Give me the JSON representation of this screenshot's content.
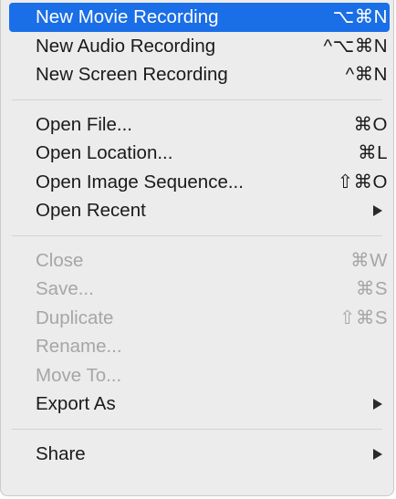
{
  "menu": {
    "groups": [
      {
        "items": [
          {
            "label": "New Movie Recording",
            "shortcut": "⌥⌘N",
            "state": "highlighted"
          },
          {
            "label": "New Audio Recording",
            "shortcut": "^⌥⌘N",
            "state": "enabled"
          },
          {
            "label": "New Screen Recording",
            "shortcut": "^⌘N",
            "state": "enabled"
          }
        ]
      },
      {
        "items": [
          {
            "label": "Open File...",
            "shortcut": "⌘O",
            "state": "enabled"
          },
          {
            "label": "Open Location...",
            "shortcut": "⌘L",
            "state": "enabled"
          },
          {
            "label": "Open Image Sequence...",
            "shortcut": "⇧⌘O",
            "state": "enabled"
          },
          {
            "label": "Open Recent",
            "shortcut": "",
            "state": "enabled",
            "submenu": true
          }
        ]
      },
      {
        "items": [
          {
            "label": "Close",
            "shortcut": "⌘W",
            "state": "disabled"
          },
          {
            "label": "Save...",
            "shortcut": "⌘S",
            "state": "disabled"
          },
          {
            "label": "Duplicate",
            "shortcut": "⇧⌘S",
            "state": "disabled"
          },
          {
            "label": "Rename...",
            "shortcut": "",
            "state": "disabled"
          },
          {
            "label": "Move To...",
            "shortcut": "",
            "state": "disabled"
          },
          {
            "label": "Export As",
            "shortcut": "",
            "state": "enabled",
            "submenu": true
          }
        ]
      },
      {
        "items": [
          {
            "label": "Share",
            "shortcut": "",
            "state": "enabled",
            "submenu": true
          }
        ]
      }
    ],
    "colors": {
      "highlight": "#1a6ee8",
      "menu_background": "#ececec",
      "disabled_text": "#a6a6a6",
      "text": "#1a1a1a"
    }
  }
}
